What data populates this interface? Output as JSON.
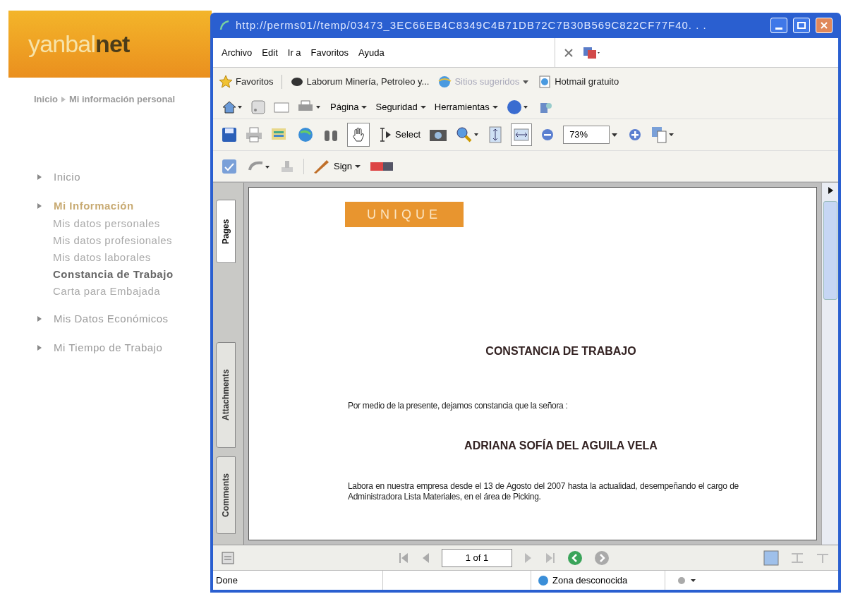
{
  "logo": {
    "first": "yanbal",
    "second": "net"
  },
  "breadcrumb": [
    {
      "label": "Inicio"
    },
    {
      "label": "Mi información personal"
    }
  ],
  "nav": [
    {
      "label": "Inicio",
      "selected": false
    },
    {
      "label": "Mi Información",
      "selected": true,
      "children": [
        {
          "label": "Mis datos personales",
          "selected": false
        },
        {
          "label": "Mis datos profesionales",
          "selected": false
        },
        {
          "label": "Mis datos laborales",
          "selected": false
        },
        {
          "label": "Constancia de Trabajo",
          "selected": true
        },
        {
          "label": "Carta para Embajada",
          "selected": false
        }
      ]
    },
    {
      "label": "Mis Datos Económicos",
      "selected": false
    },
    {
      "label": "Mi Tiempo de Trabajo",
      "selected": false
    }
  ],
  "browser": {
    "title": "http://perms01//temp/03473_3EC66EB4C8349C4B71DB72C7B30B569C822CF77F40. . .",
    "menu": [
      "Archivo",
      "Edit",
      "Ir a",
      "Favoritos",
      "Ayuda"
    ],
    "favorites": [
      {
        "label": "Favoritos",
        "disabled": false
      },
      {
        "label": "Laborum Minería, Petroleo y...",
        "disabled": false
      },
      {
        "label": "Sitios sugeridos",
        "disabled": true
      },
      {
        "label": "Hotmail gratuito",
        "disabled": false
      }
    ],
    "commands": [
      "Página",
      "Seguridad",
      "Herramientas"
    ],
    "select_label": "Select",
    "zoom": "73%",
    "sign_label": "Sign",
    "side_tabs": [
      {
        "label": "Pages",
        "selected": true
      },
      {
        "label": "Attachments",
        "selected": false
      },
      {
        "label": "Comments",
        "selected": false
      }
    ],
    "document": {
      "logo": "UNIQUE",
      "heading": "CONSTANCIA DE TRABAJO",
      "intro": "Por medio de la presente, dejamos constancia que la señora :",
      "name": "ADRIANA SOFÍA DEL AGUILA VELA",
      "body": "Labora en nuestra empresa desde el 13 de Agosto del 2007 hasta la actualidad, desempeñando el cargo de Administradora Lista Materiales, en el área de Picking."
    },
    "page_indicator": "1 of 1",
    "status": "Done",
    "zone": "Zona desconocida"
  }
}
